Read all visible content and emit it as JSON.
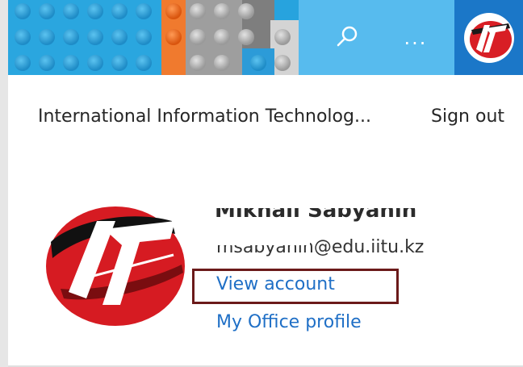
{
  "header": {
    "search_icon": "search-icon",
    "more_label": "...",
    "avatar_icon": "it-logo"
  },
  "org": {
    "name": "International Information Technolog...",
    "signout_label": "Sign out"
  },
  "account": {
    "name": "Mikhail Sabyanin",
    "email": "msabyanin@edu.iitu.kz",
    "view_account_label": "View account",
    "office_profile_label": "My Office profile"
  },
  "colors": {
    "link": "#1f6fc6",
    "highlight_border": "#6b1a1a",
    "header_blue": "#27a3de"
  }
}
